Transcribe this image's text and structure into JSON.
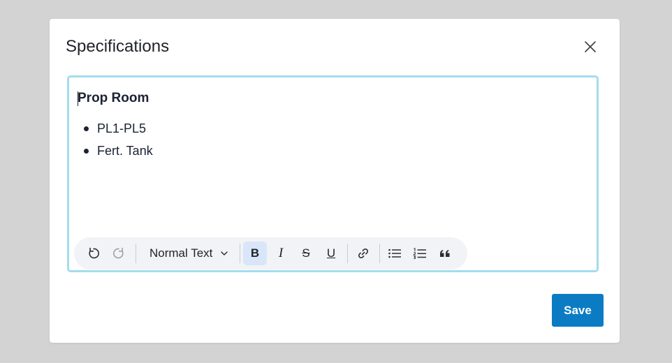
{
  "modal": {
    "title": "Specifications",
    "close_icon": "close-icon"
  },
  "editor": {
    "heading": "Prop Room",
    "bullets": [
      "PL1-PL5",
      "Fert. Tank"
    ],
    "border_color": "#a4dcef"
  },
  "toolbar": {
    "undo_icon": "undo-icon",
    "redo_icon": "redo-icon",
    "block_type": "Normal Text",
    "bold_label": "B",
    "italic_label": "I",
    "strike_label": "S",
    "underline_label": "U",
    "link_icon": "link-icon",
    "bullet_list_icon": "bullet-list-icon",
    "ordered_list_icon": "ordered-list-icon",
    "quote_icon": "quote-icon",
    "active": "bold"
  },
  "footer": {
    "save_label": "Save",
    "save_color": "#0b7cc4"
  }
}
